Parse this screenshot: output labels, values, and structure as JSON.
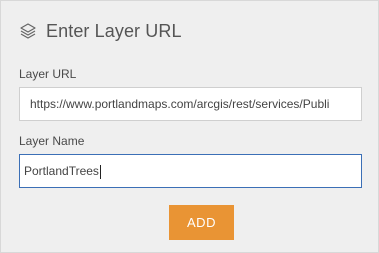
{
  "header": {
    "icon": "layers-icon",
    "title": "Enter Layer URL"
  },
  "form": {
    "layer_url": {
      "label": "Layer URL",
      "value": "https://www.portlandmaps.com/arcgis/rest/services/Publi"
    },
    "layer_name": {
      "label": "Layer Name",
      "value": "PortlandTrees"
    }
  },
  "actions": {
    "add_label": "ADD"
  },
  "colors": {
    "panel_background": "#efefef",
    "accent_button": "#e99434",
    "focus_border": "#3b6fb6"
  }
}
